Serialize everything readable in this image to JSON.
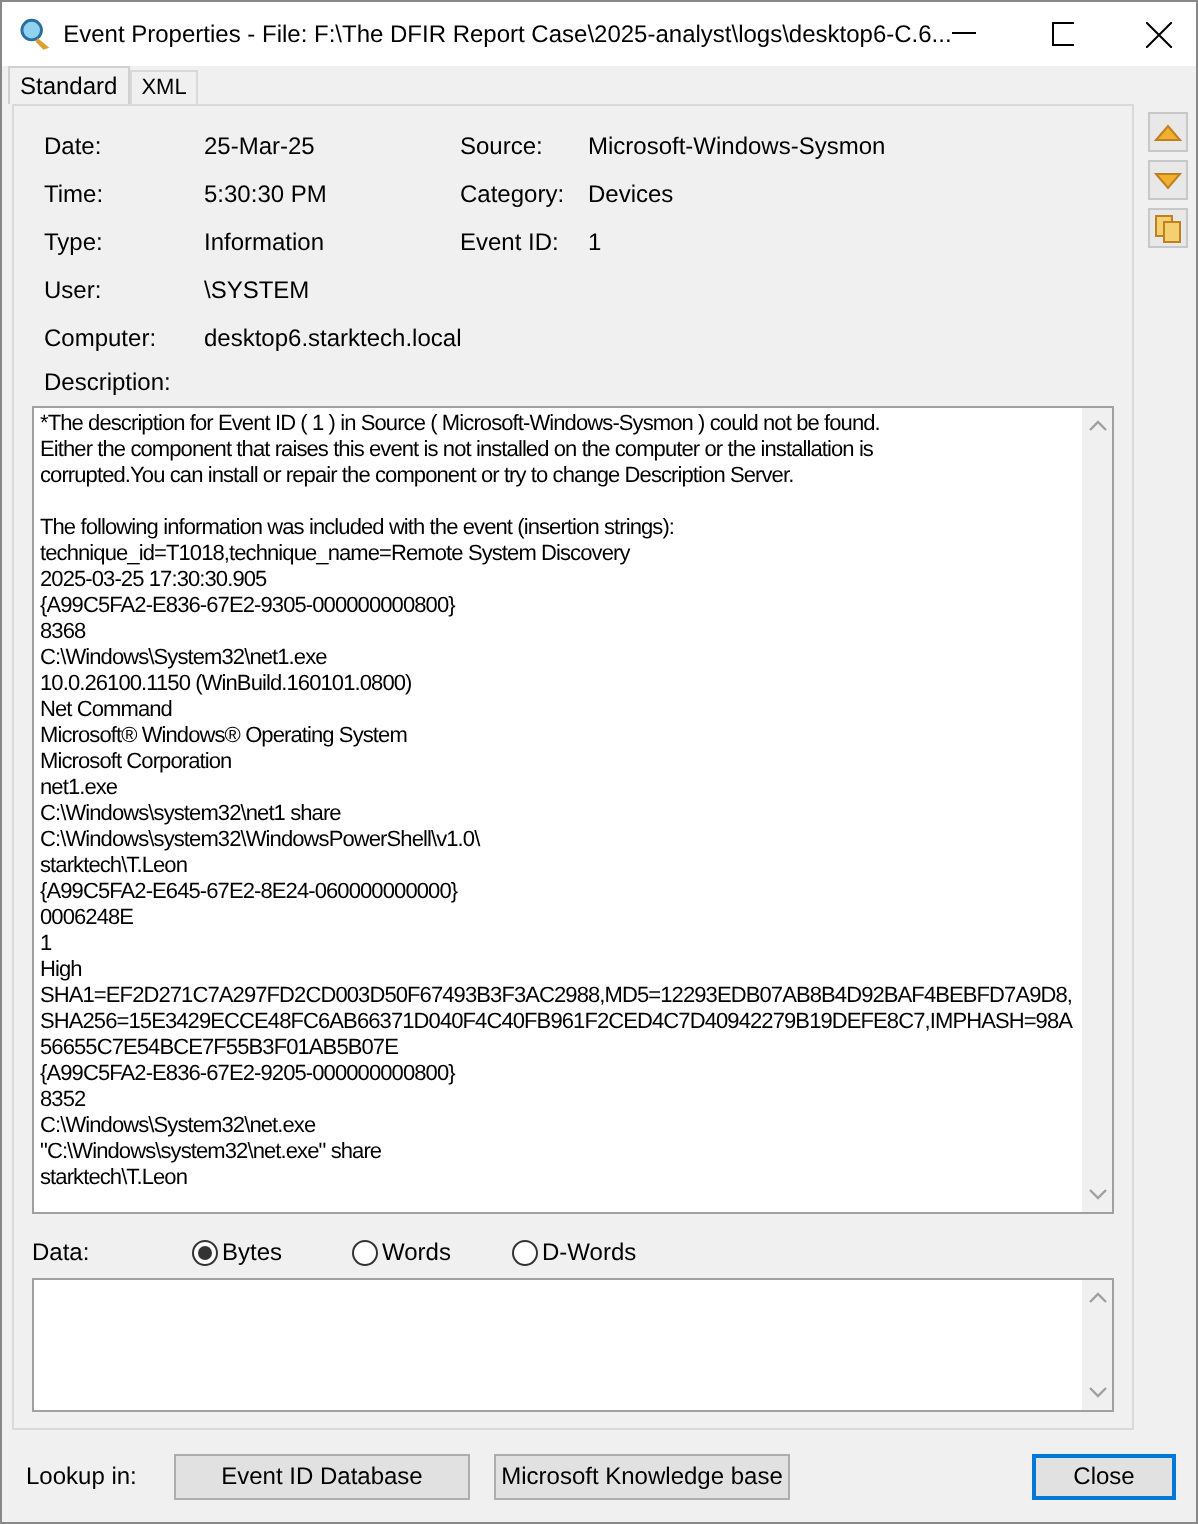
{
  "window": {
    "title": "Event Properties - File: F:\\The DFIR Report Case\\2025-analyst\\logs\\desktop6-C.6..."
  },
  "tabs": [
    {
      "label": "Standard",
      "selected": true
    },
    {
      "label": "XML",
      "selected": false
    }
  ],
  "field_rows": [
    [
      {
        "label": "Date:",
        "value": "25-Mar-25"
      },
      {
        "label": "Source:",
        "value": "Microsoft-Windows-Sysmon"
      }
    ],
    [
      {
        "label": "Time:",
        "value": "5:30:30 PM"
      },
      {
        "label": "Category:",
        "value": "Devices"
      }
    ],
    [
      {
        "label": "Type:",
        "value": "Information"
      },
      {
        "label": "Event ID:",
        "value": "1"
      }
    ],
    [
      {
        "label": "User:",
        "value": "\\SYSTEM"
      }
    ],
    [
      {
        "label": "Computer:",
        "value": "desktop6.starktech.local"
      }
    ]
  ],
  "description": {
    "label": "Description:",
    "paragraphs": [
      [
        "*The description for Event ID ( 1 ) in Source ( Microsoft-Windows-Sysmon ) could not be found.",
        "Either the component that raises this event is not installed on the computer or the installation is",
        "corrupted.You can install or repair the component or try to change Description Server."
      ],
      [
        "The following information was included with the event (insertion strings):",
        "technique_id=T1018,technique_name=Remote System Discovery",
        "2025-03-25 17:30:30.905",
        "{A99C5FA2-E836-67E2-9305-000000000800}",
        "8368",
        "C:\\Windows\\System32\\net1.exe",
        "10.0.26100.1150 (WinBuild.160101.0800)",
        "Net Command",
        "Microsoft® Windows® Operating System",
        "Microsoft Corporation",
        "net1.exe",
        "C:\\Windows\\system32\\net1 share",
        "C:\\Windows\\system32\\WindowsPowerShell\\v1.0\\",
        "starktech\\T.Leon",
        "{A99C5FA2-E645-67E2-8E24-060000000000}",
        "0006248E",
        "1",
        "High",
        "SHA1=EF2D271C7A297FD2CD003D50F67493B3F3AC2988,MD5=12293EDB07AB8B4D92BAF4BEBFD7A9D8,",
        "SHA256=15E3429ECCE48FC6AB66371D040F4C40FB961F2CED4C7D40942279B19DEFE8C7,IMPHASH=98A",
        "56655C7E54BCE7F55B3F01AB5B07E",
        "{A99C5FA2-E836-67E2-9205-000000000800}",
        "8352",
        "C:\\Windows\\System32\\net.exe",
        "\"C:\\Windows\\system32\\net.exe\" share",
        "starktech\\T.Leon"
      ]
    ]
  },
  "data": {
    "label": "Data:",
    "formats": [
      {
        "label": "Bytes",
        "selected": true
      },
      {
        "label": "Words",
        "selected": false
      },
      {
        "label": "D-Words",
        "selected": false
      }
    ]
  },
  "footer": {
    "lookup_label": "Lookup in:",
    "lookup_buttons": [
      "Event ID Database",
      "Microsoft Knowledge base"
    ],
    "close": "Close"
  }
}
